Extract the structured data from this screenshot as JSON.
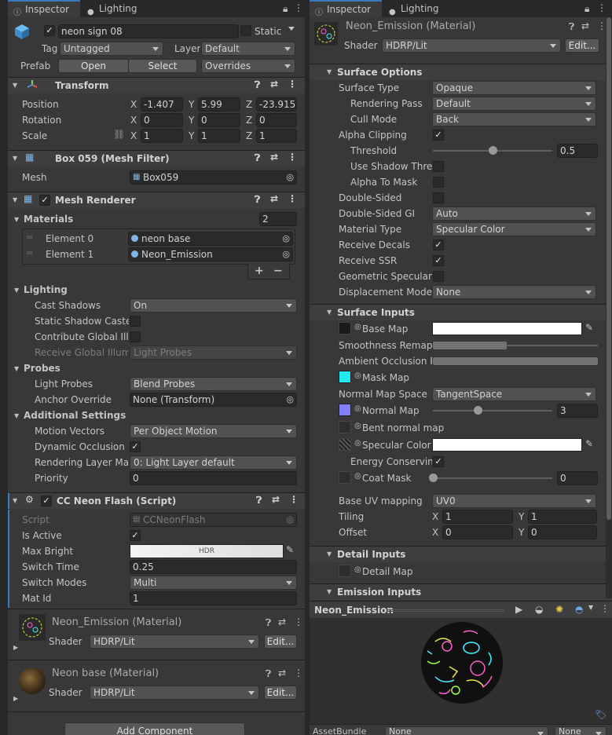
{
  "left": {
    "tabs": {
      "inspector": "Inspector",
      "lighting": "Lighting"
    },
    "object": {
      "name": "neon sign 08",
      "static_label": "Static",
      "tag_label": "Tag",
      "tag": "Untagged",
      "layer_label": "Layer",
      "layer": "Default",
      "prefab_label": "Prefab",
      "open": "Open",
      "select": "Select",
      "overrides": "Overrides"
    },
    "transform": {
      "title": "Transform",
      "position_label": "Position",
      "rotation_label": "Rotation",
      "scale_label": "Scale",
      "position": {
        "x": "-1.407",
        "y": "5.99",
        "z": "-23.915"
      },
      "rotation": {
        "x": "0",
        "y": "0",
        "z": "0"
      },
      "scale": {
        "x": "1",
        "y": "1",
        "z": "1"
      }
    },
    "axes": {
      "x": "X",
      "y": "Y",
      "z": "Z"
    },
    "mesh_filter": {
      "title": "Box 059 (Mesh Filter)",
      "mesh_label": "Mesh",
      "mesh": "Box059"
    },
    "mesh_renderer": {
      "title": "Mesh Renderer",
      "materials_label": "Materials",
      "materials_count": "2",
      "elements": [
        {
          "label": "Element 0",
          "value": "neon base"
        },
        {
          "label": "Element 1",
          "value": "Neon_Emission"
        }
      ],
      "plus": "+",
      "minus": "−",
      "lighting_label": "Lighting",
      "cast_shadows_label": "Cast Shadows",
      "cast_shadows": "On",
      "static_shadow_label": "Static Shadow Caste",
      "contribute_gi_label": "Contribute Global Illu",
      "receive_gi_label": "Receive Global Illumi",
      "receive_gi": "Light Probes",
      "probes_label": "Probes",
      "light_probes_label": "Light Probes",
      "light_probes": "Blend Probes",
      "anchor_label": "Anchor Override",
      "anchor": "None (Transform)",
      "additional_label": "Additional Settings",
      "motion_label": "Motion Vectors",
      "motion": "Per Object Motion",
      "dynamic_occ_label": "Dynamic Occlusion",
      "rendering_layer_label": "Rendering Layer Mas",
      "rendering_layer": "0: Light Layer default",
      "priority_label": "Priority",
      "priority": "0"
    },
    "script": {
      "title": "CC Neon Flash (Script)",
      "script_label": "Script",
      "script_value": "CCNeonFlash",
      "is_active_label": "Is Active",
      "max_bright_label": "Max Bright",
      "hdr": "HDR",
      "switch_time_label": "Switch Time",
      "switch_time": "0.25",
      "switch_modes_label": "Switch Modes",
      "switch_modes": "Multi",
      "mat_id_label": "Mat Id",
      "mat_id": "1"
    },
    "materials": [
      {
        "name": "Neon_Emission (Material)",
        "shader_label": "Shader",
        "shader": "HDRP/Lit",
        "edit": "Edit..."
      },
      {
        "name": "Neon base (Material)",
        "shader_label": "Shader",
        "shader": "HDRP/Lit",
        "edit": "Edit..."
      }
    ],
    "add_component": "Add Component"
  },
  "right": {
    "tabs": {
      "inspector": "Inspector",
      "lighting": "Lighting"
    },
    "material": {
      "name": "Neon_Emission (Material)",
      "shader_label": "Shader",
      "shader": "HDRP/Lit",
      "edit": "Edit..."
    },
    "surface_options": {
      "title": "Surface Options",
      "surface_type_label": "Surface Type",
      "surface_type": "Opaque",
      "rendering_pass_label": "Rendering Pass",
      "rendering_pass": "Default",
      "cull_mode_label": "Cull Mode",
      "cull_mode": "Back",
      "alpha_clipping_label": "Alpha Clipping",
      "threshold_label": "Threshold",
      "threshold": "0.5",
      "threshold_fraction": 0.5,
      "shadow_thresh_label": "Use Shadow Thres",
      "alpha_to_mask_label": "Alpha To Mask",
      "double_sided_label": "Double-Sided",
      "double_sided_gi_label": "Double-Sided GI",
      "double_sided_gi": "Auto",
      "material_type_label": "Material Type",
      "material_type": "Specular Color",
      "receive_decals_label": "Receive Decals",
      "receive_ssr_label": "Receive SSR",
      "geometric_label": "Geometric Specular A",
      "displacement_label": "Displacement Mode",
      "displacement": "None"
    },
    "surface_inputs": {
      "title": "Surface Inputs",
      "base_map_label": "Base Map",
      "smoothness_label": "Smoothness Remapp",
      "ao_label": "Ambient Occlusion Re",
      "mask_map_label": "Mask Map",
      "normal_space_label": "Normal Map Space",
      "normal_space": "TangentSpace",
      "normal_map_label": "Normal Map",
      "normal_value": "3",
      "normal_fraction": 0.375,
      "bent_label": "Bent normal map",
      "specular_label": "Specular Color",
      "energy_label": "Energy Conserving",
      "coat_label": "Coat Mask",
      "coat_value": "0",
      "coat_fraction": 0,
      "uv_label": "Base UV mapping",
      "uv": "UV0",
      "tiling_label": "Tiling",
      "tiling": {
        "x": "1",
        "y": "1"
      },
      "offset_label": "Offset",
      "offset": {
        "x": "0",
        "y": "0"
      }
    },
    "axes": {
      "x": "X",
      "y": "Y"
    },
    "detail": {
      "title": "Detail Inputs",
      "detail_map_label": "Detail Map"
    },
    "emission": {
      "title": "Emission Inputs"
    },
    "preview": {
      "title": "Neon_Emission"
    },
    "bottom": {
      "assetbundle_label": "AssetBundle",
      "bundle": "None",
      "variant": "None"
    }
  },
  "colors": {
    "accent": "#3a79bb",
    "mask_map": "#22e8f0",
    "normal_map": "#8080ff",
    "checkbox_blue": "#4a8ad4"
  }
}
